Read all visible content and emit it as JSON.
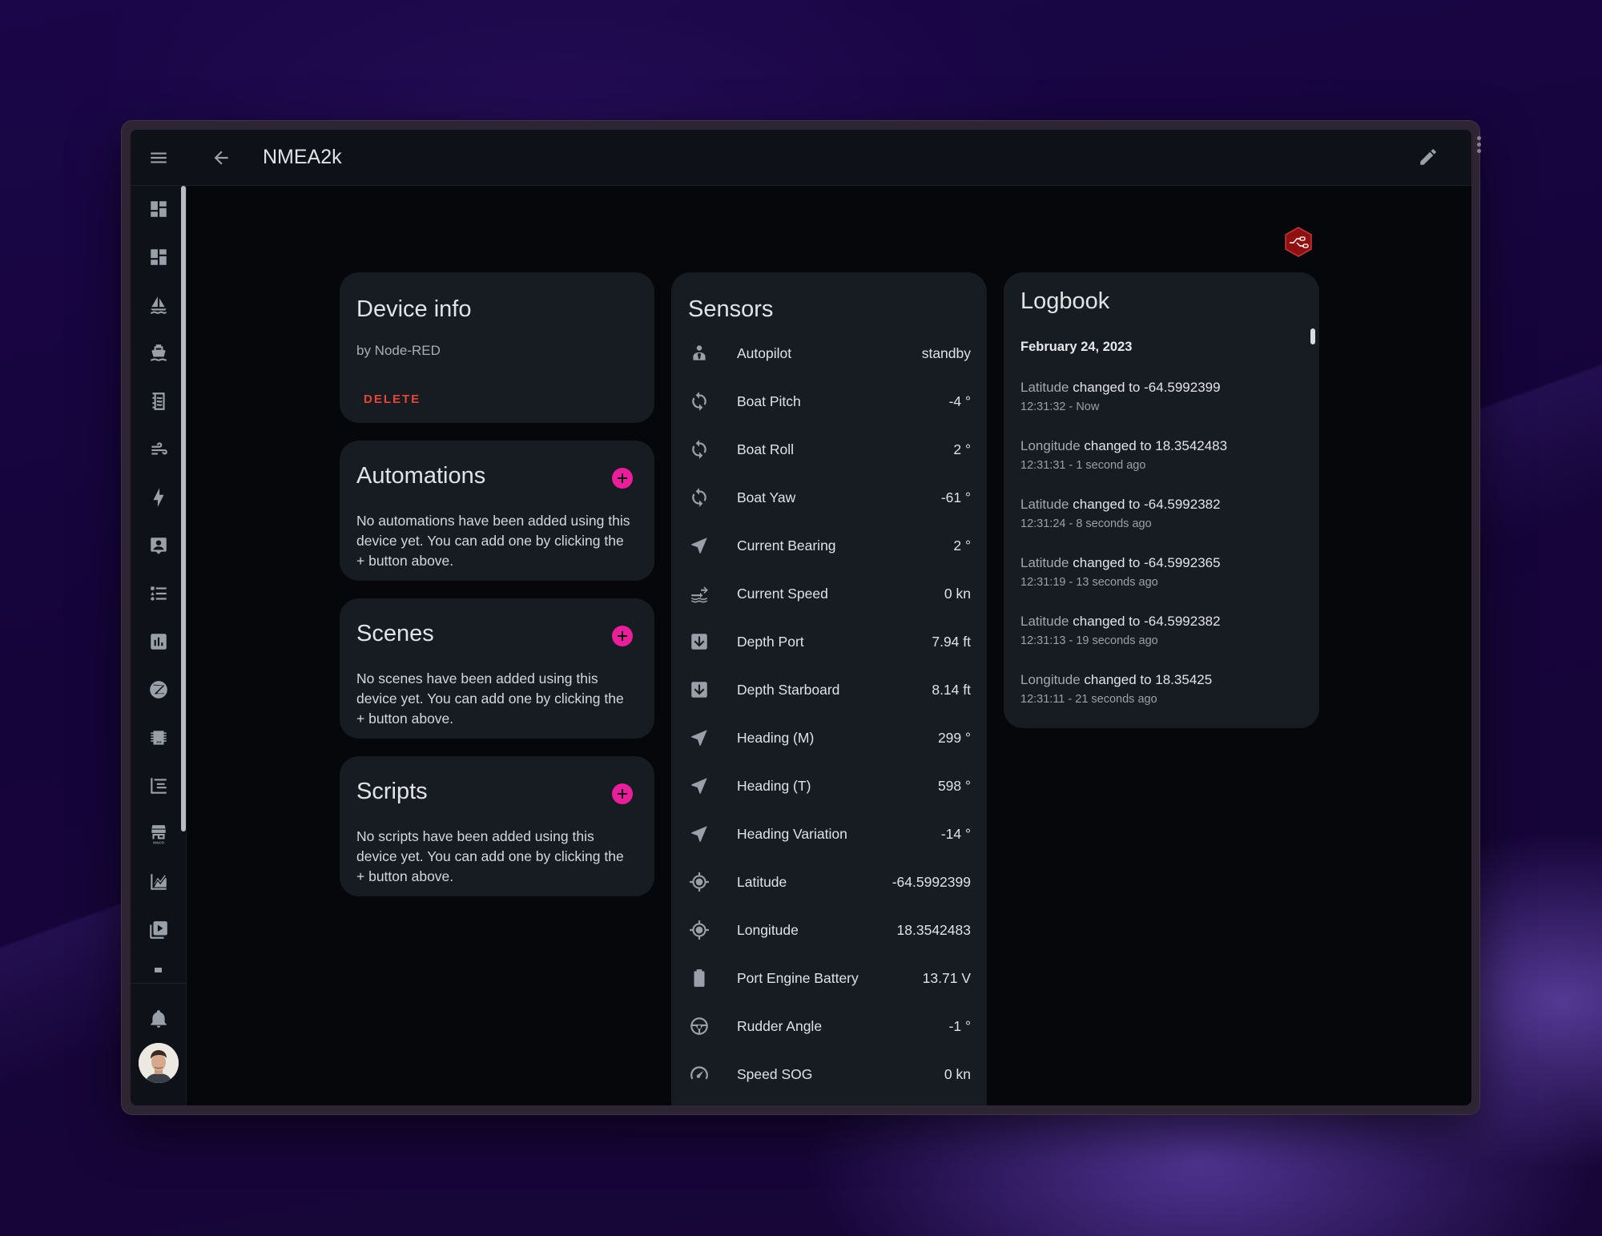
{
  "header": {
    "title": "NMEA2k"
  },
  "sidebar": {
    "items": [
      {
        "icon": "dashboard-icon",
        "label": "Overview"
      },
      {
        "icon": "dashboard-icon",
        "label": "Dashboard"
      },
      {
        "icon": "sailboat-icon",
        "label": "Sailboat"
      },
      {
        "icon": "ferry-icon",
        "label": "Ferry"
      },
      {
        "icon": "notebook-icon",
        "label": "Logbook"
      },
      {
        "icon": "weather-windy-icon",
        "label": "Wind"
      },
      {
        "icon": "lightning-bolt-icon",
        "label": "Energy"
      },
      {
        "icon": "account-box-icon",
        "label": "Person"
      },
      {
        "icon": "format-list-icon",
        "label": "List"
      },
      {
        "icon": "chart-box-icon",
        "label": "Chart"
      },
      {
        "icon": "zigbee-icon",
        "label": "Zigbee"
      },
      {
        "icon": "chip-icon",
        "label": "Chip"
      },
      {
        "icon": "chart-gantt-icon",
        "label": "Gantt"
      },
      {
        "icon": "hacs-store-icon",
        "label": "HACS"
      },
      {
        "icon": "chart-areaspline-icon",
        "label": "History"
      },
      {
        "icon": "play-box-multiple-icon",
        "label": "Media"
      }
    ],
    "hacs_label": "HACS"
  },
  "device_info": {
    "title": "Device info",
    "manufacturer": "by Node-RED",
    "delete_label": "DELETE"
  },
  "automations": {
    "title": "Automations",
    "empty_text": "No automations have been added using this device yet. You can add one by clicking the + button above."
  },
  "scenes": {
    "title": "Scenes",
    "empty_text": "No scenes have been added using this device yet. You can add one by clicking the + button above."
  },
  "scripts": {
    "title": "Scripts",
    "empty_text": "No scripts have been added using this device yet. You can add one by clicking the + button above."
  },
  "sensors": {
    "title": "Sensors",
    "rows": [
      {
        "icon": "account-tie-icon",
        "name": "Autopilot",
        "value": "standby"
      },
      {
        "icon": "sync-icon",
        "name": "Boat Pitch",
        "value": "-4 °"
      },
      {
        "icon": "sync-icon",
        "name": "Boat Roll",
        "value": "2 °"
      },
      {
        "icon": "sync-icon",
        "name": "Boat Yaw",
        "value": "-61 °"
      },
      {
        "icon": "navigation-icon",
        "name": "Current Bearing",
        "value": "2 °"
      },
      {
        "icon": "current-speed-icon",
        "name": "Current Speed",
        "value": "0 kn"
      },
      {
        "icon": "arrow-down-box-icon",
        "name": "Depth Port",
        "value": "7.94 ft"
      },
      {
        "icon": "arrow-down-box-icon",
        "name": "Depth Starboard",
        "value": "8.14 ft"
      },
      {
        "icon": "navigation-icon",
        "name": "Heading (M)",
        "value": "299 °"
      },
      {
        "icon": "navigation-icon",
        "name": "Heading (T)",
        "value": "598 °"
      },
      {
        "icon": "navigation-icon",
        "name": "Heading Variation",
        "value": "-14 °"
      },
      {
        "icon": "crosshairs-gps-icon",
        "name": "Latitude",
        "value": "-64.5992399"
      },
      {
        "icon": "crosshairs-gps-icon",
        "name": "Longitude",
        "value": "18.3542483"
      },
      {
        "icon": "battery-icon",
        "name": "Port Engine Battery",
        "value": "13.71 V"
      },
      {
        "icon": "steering-icon",
        "name": "Rudder Angle",
        "value": "-1 °"
      },
      {
        "icon": "speedometer-icon",
        "name": "Speed SOG",
        "value": "0 kn"
      }
    ]
  },
  "logbook": {
    "title": "Logbook",
    "date": "February 24, 2023",
    "entries": [
      {
        "entity": "Latitude",
        "message": "changed to -64.5992399",
        "time": "12:31:32 - Now"
      },
      {
        "entity": "Longitude",
        "message": "changed to 18.3542483",
        "time": "12:31:31 - 1 second ago"
      },
      {
        "entity": "Latitude",
        "message": "changed to -64.5992382",
        "time": "12:31:24 - 8 seconds ago"
      },
      {
        "entity": "Latitude",
        "message": "changed to -64.5992365",
        "time": "12:31:19 - 13 seconds ago"
      },
      {
        "entity": "Latitude",
        "message": "changed to -64.5992382",
        "time": "12:31:13 - 19 seconds ago"
      },
      {
        "entity": "Longitude",
        "message": "changed to 18.35425",
        "time": "12:31:11 - 21 seconds ago"
      }
    ]
  },
  "colors": {
    "accent_plus": "#e91e9b",
    "delete": "#e54536",
    "node_red": "#8f1010"
  }
}
